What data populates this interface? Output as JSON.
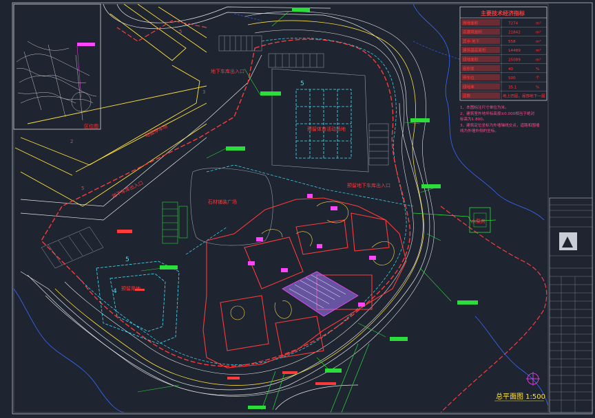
{
  "drawing": {
    "title": "总平面图 1:500",
    "inset_label": "区位图",
    "labels": {
      "underground_entry_1": "地下车库出入口",
      "underground_entry_2": "地下车库出入口",
      "underground_entry_3": "预留地下车库出入口",
      "parking_lot": "地面停车场",
      "stone_plaza": "石材铺装广场",
      "sports_ground": "预留体育活动场地",
      "reserved_area": "预留用地",
      "pump_station": "水泵房",
      "building_2": "2",
      "building_3": "3",
      "building_4": "4",
      "building_5a": "5",
      "building_5b": "5",
      "building_5c": "5",
      "building_5d": "5"
    }
  },
  "tech_table": {
    "header": "主要技术经济指标",
    "rows": [
      {
        "label": "用地面积",
        "value": "7274",
        "unit": "m²"
      },
      {
        "label": "总建筑面积",
        "value": "21842",
        "unit": "m²"
      },
      {
        "label": "其中  地下",
        "value": "558",
        "unit": "m²"
      },
      {
        "label": "建筑基底面积",
        "value": "14489",
        "unit": "m²"
      },
      {
        "label": "绿地面积",
        "value": "25089",
        "unit": "m²"
      },
      {
        "label": "容积率",
        "value": "40",
        "unit": "%"
      },
      {
        "label": "停车位",
        "value": "500",
        "unit": "个"
      },
      {
        "label": "绿地率",
        "value": "35.1",
        "unit": "%"
      },
      {
        "label": "层数",
        "value": "地上四层，局部地下一层",
        "unit": ""
      }
    ]
  },
  "notes": [
    "1、本图标注尺寸单位为米。",
    "2、建筑室外地坪标高按±0.000相当于绝对",
    "   标高为1.800。",
    "3、建筑定位坐标为外墙轴线交点，道路和围墙",
    "   线为外墙外侧的坐标。"
  ],
  "colors": {
    "background": "#1e2430",
    "road_line": "#e8e8e8",
    "cyan": "#44e6ff",
    "red": "#ff3b3b",
    "yellow": "#ffe23a",
    "magenta": "#ff44ff",
    "green": "#2bdc3a",
    "blue": "#3a6bff"
  }
}
